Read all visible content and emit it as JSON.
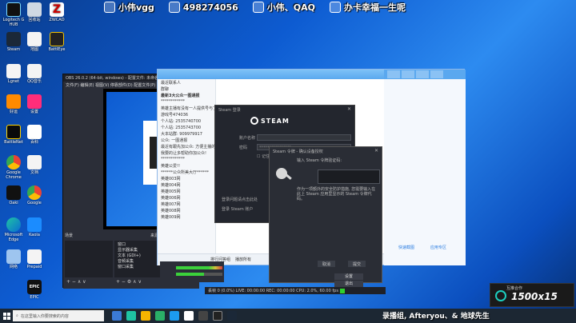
{
  "banner": {
    "items": [
      "小伟vgg",
      "498274056",
      "小伟、QAQ",
      "办卡幸福一生呢"
    ]
  },
  "desktop_icons": [
    "Logitech G HUB",
    "回收站",
    "ZWCAD",
    "Steam",
    "地图",
    "BattlEye",
    "Lgnet",
    "QQ音乐",
    "好运",
    "设置",
    "BattleNet",
    "百科",
    "Google Chrome",
    "文档",
    "Oaki",
    "Google",
    "Microsoft Edge",
    "Kaola",
    "网络",
    "Prepaid",
    "EPIC"
  ],
  "obs": {
    "title": "OBS 26.0.2 (64-bit, windows) - 配置文件: 未命名 - 场景: 未命名",
    "menu": "文件(F) 编辑(E) 视图(V) 停靠部件(D) 配置文件(P) 场景集合(S) 工具(T) 帮助(H)",
    "scenes_label": "场景",
    "sources_label": "来源",
    "sources": [
      "窗口",
      "显示器采集",
      "文本 (GDI+)",
      "音频采集",
      "窗口采集"
    ],
    "status": "丢帧 0 (0.0%)   LIVE: 00:00:00   REC: 00:00:00   CPU: 2.0%, 60.00 fps",
    "settings_button": "设置",
    "exit_button": "退出"
  },
  "qq": {
    "title": "",
    "sidebar_rows": [
      "最近联系人",
      "群聊",
      "最新3大公众一图通报",
      "************",
      "英雄主播有没有一人提供号与丁?",
      "游戏号474036",
      "个人站: 2535740700",
      "个人站: 2535743700",
      "大本站群: 909979917",
      "公众: 一图通报",
      "最近有跟先加公众: 方便主播的",
      "我要的让多帮助你加公众!",
      "************",
      "英雄公爱!!",
      "******公众所美大厅******",
      "英雄003网",
      "英雄004网",
      "英雄005网",
      "英雄006网",
      "英雄007网",
      "英雄008网",
      "英雄009网"
    ],
    "bottom_items": [
      "排行问答组",
      "播放所有"
    ],
    "right_links": [
      "快速截图",
      "应用专区"
    ]
  },
  "steam_login": {
    "title": "Steam 登录",
    "logo": "STEAM",
    "account_label": "账户名称",
    "account_value": "",
    "password_label": "密码",
    "password_value": "****************",
    "remember_label": "记住我的密码",
    "footer1": "登录问题请点击此处",
    "footer2": "登录 Steam 账户"
  },
  "steam_guard": {
    "title": "Steam 令牌 - 确认设备授权",
    "prompt": "输入 Steam 令牌验证码:",
    "info": "作为一项额外的安全防护措施, 您需要输入在此上 Steam 应用里显示的 Steam 令牌代码。",
    "cancel": "取消",
    "submit": "提交"
  },
  "taskbar": {
    "search_placeholder": "在这里输入你要搜索的内容"
  },
  "record_overlay": {
    "left": "录播组, Afteryou、& 地球先生",
    "small": "互推合作",
    "big": "1500x15"
  },
  "colors": {
    "steam_bg": "#23262e",
    "qq_blue": "#5aa8ef",
    "obs_bg": "#2b2e38"
  }
}
